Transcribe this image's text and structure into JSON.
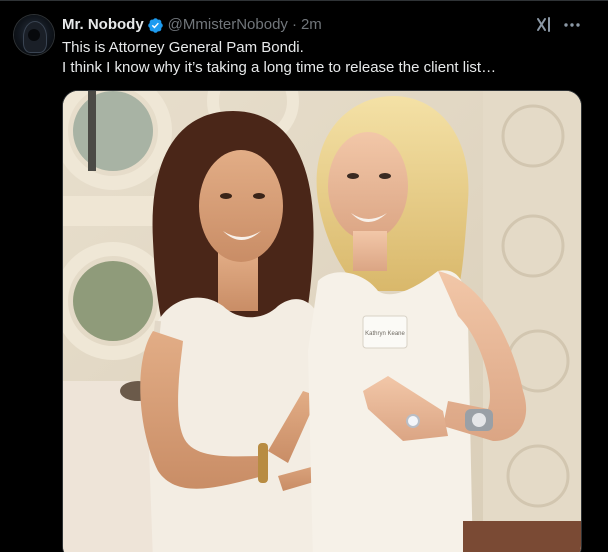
{
  "tweet": {
    "author": {
      "display_name": "Mr. Nobody",
      "handle": "@MmisterNobody",
      "verified": true,
      "avatar_icon": "hooded-figure-avatar"
    },
    "separator": "·",
    "timestamp": "2m",
    "text_lines": [
      "This is Attorney General Pam Bondi.",
      "I think I know why it’s taking a long time to release the client list…"
    ],
    "media": {
      "kind": "photo",
      "badge_text": "Kathryn Keane"
    },
    "icons": {
      "grok": "grok-icon",
      "more": "more-options-icon",
      "verified": "verified-badge-icon"
    }
  },
  "colors": {
    "background": "#000000",
    "text_primary": "#e7e9ea",
    "text_secondary": "#71767b",
    "verified_blue": "#1d9bf0",
    "border": "#2f3336"
  }
}
